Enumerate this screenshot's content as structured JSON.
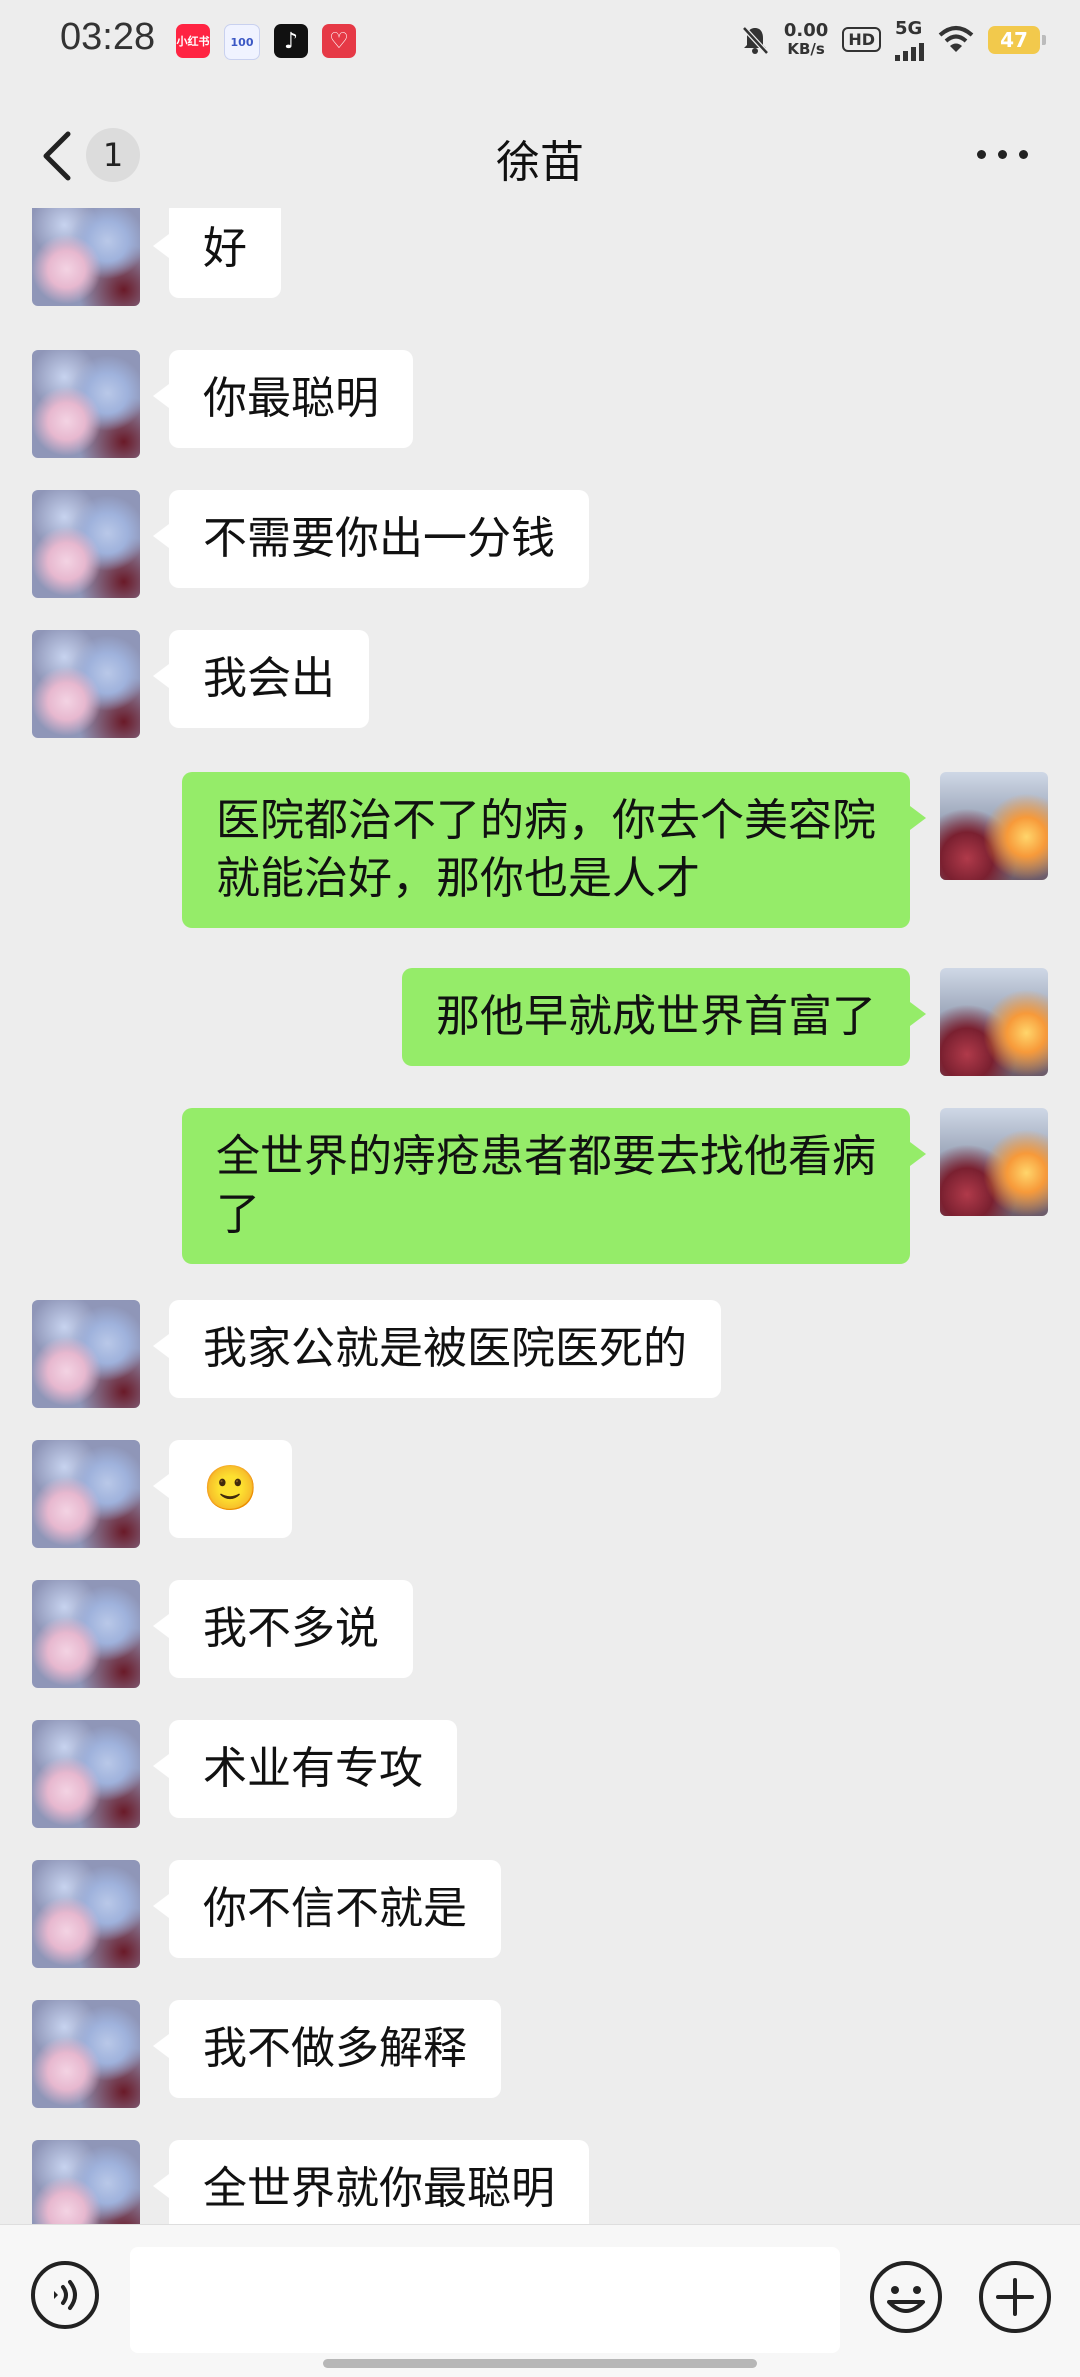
{
  "status_bar": {
    "time": "03:28",
    "net_speed": "0.00",
    "net_unit": "KB/s",
    "hd_label": "HD",
    "network": "5G",
    "battery": "47",
    "apps": [
      {
        "label": "小红书",
        "color": "#ff2442"
      },
      {
        "label": "100",
        "color": "#f0f3ff"
      },
      {
        "label": "♪",
        "color": "#111111"
      },
      {
        "label": "♡",
        "color": "#e63946"
      }
    ]
  },
  "header": {
    "unread_count": "1",
    "title": "徐苗"
  },
  "colors": {
    "incoming_bubble": "#ffffff",
    "outgoing_bubble": "#95ec69",
    "chat_background": "#ededed"
  },
  "messages": [
    {
      "side": "in",
      "text": "好"
    },
    {
      "side": "in",
      "text": "你最聪明"
    },
    {
      "side": "in",
      "text": "不需要你出一分钱"
    },
    {
      "side": "in",
      "text": "我会出"
    },
    {
      "side": "out",
      "text": "医院都治不了的病，你去个美容院\n就能治好，那你也是人才"
    },
    {
      "side": "out",
      "text": "那他早就成世界首富了"
    },
    {
      "side": "out",
      "text": "全世界的痔疮患者都要去找他看病\n了"
    },
    {
      "side": "in",
      "text": "我家公就是被医院医死的"
    },
    {
      "side": "in",
      "text": "🙂"
    },
    {
      "side": "in",
      "text": "我不多说"
    },
    {
      "side": "in",
      "text": "术业有专攻"
    },
    {
      "side": "in",
      "text": "你不信不就是"
    },
    {
      "side": "in",
      "text": "我不做多解释"
    },
    {
      "side": "in",
      "text": "全世界就你最聪明"
    }
  ],
  "icons": {
    "back": "chevron-left-icon",
    "more": "more-dots-icon",
    "voice": "voice-icon",
    "emoji": "emoji-icon",
    "plus": "plus-icon"
  }
}
